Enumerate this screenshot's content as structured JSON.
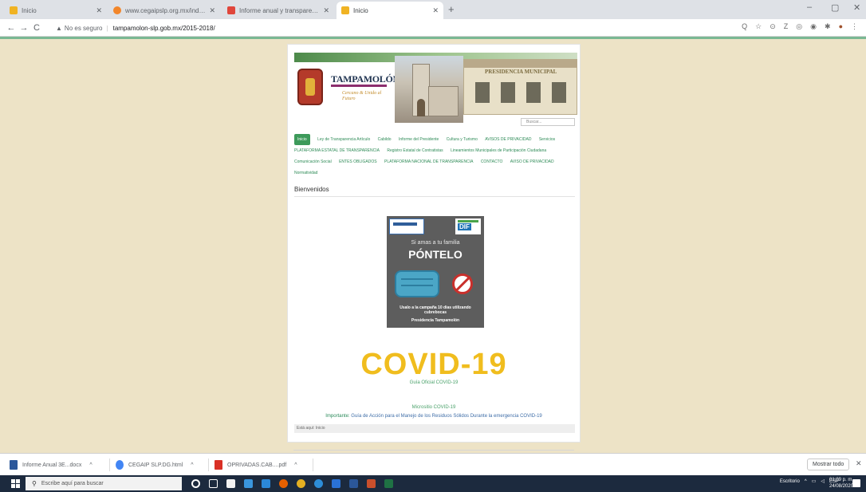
{
  "browser": {
    "tabs": [
      {
        "label": "Inicio",
        "favicon_color": "#f0b323",
        "active": false
      },
      {
        "label": "www.cegaipslp.org.mx/indicego",
        "favicon_color": "#f2862a",
        "active": false
      },
      {
        "label": "Informe anual y transparencia",
        "favicon_color": "#e0463b",
        "active": false
      },
      {
        "label": "Inicio",
        "favicon_color": "#f0b323",
        "active": true
      }
    ],
    "new_tab": "+",
    "window_controls": {
      "minimize": "–",
      "maximize": "▢",
      "close": "✕"
    },
    "nav": {
      "back": "←",
      "forward": "→",
      "reload": "C"
    },
    "address": {
      "security_label": "No es seguro",
      "url": "tampamolon-slp.gob.mx/2015-2018/"
    },
    "toolbar_icons": [
      "Q",
      "☆",
      "⊙",
      "Z",
      "◎",
      "◉",
      "✱",
      "●",
      "⋮"
    ]
  },
  "site": {
    "brand_title": "TAMPAMOLÓN",
    "brand_script": "Cercano & Unido al Futuro",
    "building_sign": "PRESIDENCIA MUNICIPAL",
    "search_placeholder": "Buscar...",
    "nav_items": [
      {
        "label": "Inicio",
        "active": true
      },
      {
        "label": "Ley de Transparencia Artículo"
      },
      {
        "label": "Cabildo"
      },
      {
        "label": "Informe del Presidente"
      },
      {
        "label": "Cultura y Turismo"
      },
      {
        "label": "AVISOS DE PRIVACIDAD"
      },
      {
        "label": "Servicios"
      },
      {
        "label": "PLATAFORMA ESTATAL DE TRANSPARENCIA"
      },
      {
        "label": "Registro Estatal de Contratistas"
      },
      {
        "label": "Lineamientos Municipales de Participación Ciudadana"
      },
      {
        "label": "Comunicación Social"
      },
      {
        "label": "ENTES OBLIGADOS"
      },
      {
        "label": "PLATAFORMA NACIONAL DE TRANSPARENCIA"
      },
      {
        "label": "CONTACTO"
      },
      {
        "label": "AVISO DE PRIVACIDAD"
      },
      {
        "label": "Normatividad"
      }
    ],
    "welcome_heading": "Bienvenidos",
    "poster": {
      "line1": "Si amas a tu familia",
      "line2": "PÓNTELO",
      "line3": "Usalo a la campaña 10 días utilizando cubrebocas",
      "line4": "Presidencia Tampamolón",
      "dif_label": "DIF"
    },
    "covid_title": "COVID-19",
    "covid_sub": "Guía Oficial COVID-19",
    "covid_link": "Micrositio COVID-19",
    "guide_lead": "Importante:",
    "guide_text": "Guía de Acción para el Manejo de los Residuos Sólidos  Durante la emergencia COVID-19",
    "breadcrumb": "Está aquí:  Inicio"
  },
  "downloads": {
    "items": [
      {
        "label": "Informe Anual 3E...docx",
        "icon_color": "#2b579a"
      },
      {
        "label": "CEGAIP SLP.DG.html",
        "icon_color": "#4285f4"
      },
      {
        "label": "OPRIVADAS.CAB....pdf",
        "icon_color": "#d93025"
      }
    ],
    "caret": "^",
    "show_all": "Mostrar todo",
    "close": "✕"
  },
  "taskbar": {
    "search_placeholder": "Escribe aquí para buscar",
    "icons": [
      {
        "name": "cortana",
        "color": "#ffffff"
      },
      {
        "name": "task-view",
        "color": "#ffffff"
      },
      {
        "name": "store",
        "color": "#f2f2f2"
      },
      {
        "name": "mail",
        "color": "#3a96dd"
      },
      {
        "name": "files",
        "color": "#2b88d8"
      },
      {
        "name": "firefox",
        "color": "#e66000"
      },
      {
        "name": "chrome",
        "color": "#e4b022"
      },
      {
        "name": "edge",
        "color": "#2d8dd8"
      },
      {
        "name": "photos",
        "color": "#2a72d6"
      },
      {
        "name": "word",
        "color": "#2b579a"
      },
      {
        "name": "paint",
        "color": "#c94f2c"
      },
      {
        "name": "excel",
        "color": "#1f7244"
      }
    ],
    "tray_label": "Escritorio",
    "language": "ESP",
    "time": "01:09 p. m.",
    "date": "24/08/2020"
  }
}
